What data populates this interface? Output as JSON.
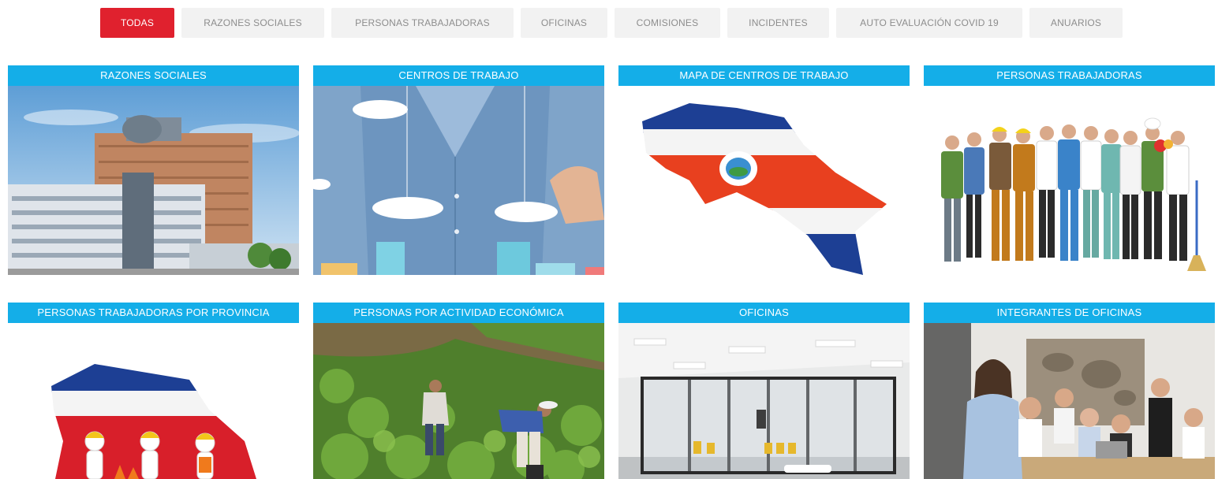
{
  "filter_tabs": [
    {
      "label": "TODAS",
      "active": true
    },
    {
      "label": "RAZONES SOCIALES",
      "active": false
    },
    {
      "label": "PERSONAS TRABAJADORAS",
      "active": false
    },
    {
      "label": "OFICINAS",
      "active": false
    },
    {
      "label": "COMISIONES",
      "active": false
    },
    {
      "label": "INCIDENTES",
      "active": false
    },
    {
      "label": "AUTO EVALUACIÓN COVID 19",
      "active": false
    },
    {
      "label": "ANUARIOS",
      "active": false
    }
  ],
  "cards": [
    {
      "title": "RAZONES SOCIALES",
      "image": "buildings-photo"
    },
    {
      "title": "CENTROS DE TRABAJO",
      "image": "business-person-city-photo"
    },
    {
      "title": "MAPA DE CENTROS DE TRABAJO",
      "image": "costa-rica-flag-map"
    },
    {
      "title": "PERSONAS TRABAJADORAS",
      "image": "workers-group-photo"
    },
    {
      "title": "PERSONAS TRABAJADORAS POR PROVINCIA",
      "image": "workers-on-flag-map"
    },
    {
      "title": "PERSONAS POR ACTIVIDAD ECONÓMICA",
      "image": "farm-workers-photo"
    },
    {
      "title": "OFICINAS",
      "image": "office-interior-photo"
    },
    {
      "title": "INTEGRANTES DE OFICINAS",
      "image": "office-meeting-photo"
    }
  ],
  "colors": {
    "accent_red": "#e0212e",
    "card_header_blue": "#14aee8",
    "tab_bg": "#f2f2f2",
    "tab_text": "#8d8d8d"
  }
}
